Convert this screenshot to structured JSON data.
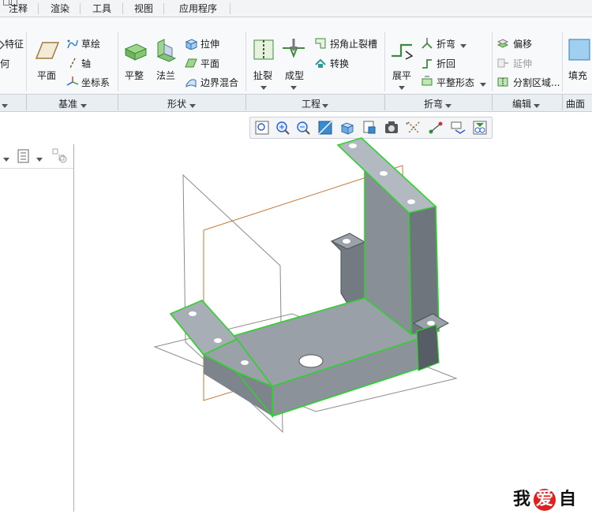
{
  "tabs": [
    "注释",
    "渲染",
    "工具",
    "视图",
    "应用程序"
  ],
  "ribbon": {
    "partial_left": {
      "feature_label": "特征",
      "second_label": "何"
    },
    "datum": {
      "plane_label": "平面",
      "sketch_label": "草绘",
      "axis_label": "轴",
      "csys_label": "坐标系",
      "group_label": "基准"
    },
    "shapes": {
      "flat_label": "平整",
      "flange_label": "法兰",
      "extrude_label": "拉伸",
      "planar_label": "平面",
      "blend_label": "边界混合",
      "group_label": "形状"
    },
    "engineering": {
      "rip_label": "扯裂",
      "form_label": "成型",
      "corner_relief_label": "拐角止裂槽",
      "convert_label": "转换",
      "group_label": "工程"
    },
    "bends": {
      "unbend_label": "展平",
      "bend_label": "折弯",
      "bend_back_label": "折回",
      "flat_state_label": "平整形态",
      "group_label": "折弯"
    },
    "editing": {
      "offset_label": "偏移",
      "extend_label": "延伸",
      "split_label": "分割区域...",
      "group_label": "编辑"
    },
    "surfaces": {
      "fill_label": "填充",
      "group_label": "曲面"
    }
  },
  "watermark": {
    "text1": "我",
    "text2": "爱",
    "text3": "自"
  },
  "colors": {
    "accent_green": "#2fd02f",
    "model_gray": "#8a9098",
    "datum_orange": "#c2701e",
    "tab_bg": "#f2f4f6"
  },
  "icons": [
    "zoom-fit-icon",
    "zoom-in-icon",
    "zoom-out-icon",
    "repaint-icon",
    "display-style-icon",
    "saved-views-icon",
    "view-manager-icon",
    "datum-display-icon",
    "annotation-display-icon",
    "spin-center-icon",
    "appearance-icon"
  ]
}
